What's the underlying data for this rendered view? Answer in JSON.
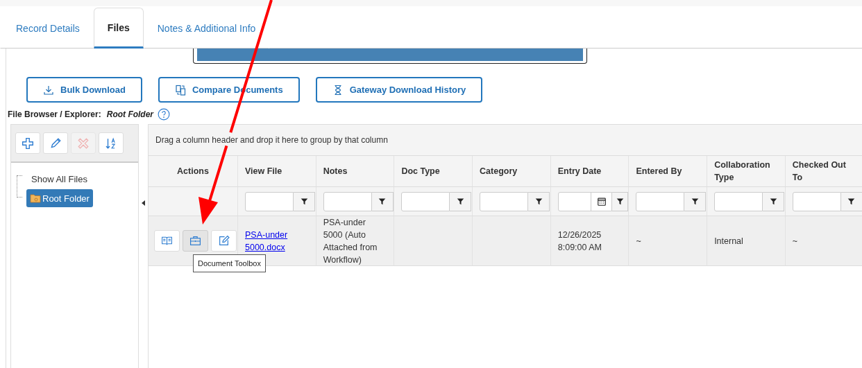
{
  "tabs": [
    {
      "label": "Record Details",
      "selected": false
    },
    {
      "label": "Files",
      "selected": true
    },
    {
      "label": "Notes & Additional Info",
      "selected": false
    }
  ],
  "toolbar_buttons": [
    {
      "kind": "download",
      "label": "Bulk Download"
    },
    {
      "kind": "compare",
      "label": "Compare Documents"
    },
    {
      "kind": "hourglass",
      "label": "Gateway Download History"
    }
  ],
  "file_browser": {
    "label": "File Browser / Explorer:",
    "folder": "Root Folder"
  },
  "tree_toolbar": [
    {
      "kind": "add",
      "disabled": false
    },
    {
      "kind": "edit",
      "disabled": false
    },
    {
      "kind": "delete",
      "disabled": true
    },
    {
      "kind": "sort",
      "disabled": false
    }
  ],
  "tree": [
    {
      "label": "Show All Files",
      "kind": "all",
      "selected": false
    },
    {
      "label": "Root Folder",
      "kind": "folder",
      "selected": true
    }
  ],
  "grid": {
    "group_hint": "Drag a column header and drop it here to group by that column",
    "columns": [
      {
        "title": "Actions",
        "kind": "actions"
      },
      {
        "title": "View File",
        "kind": "link"
      },
      {
        "title": "Notes",
        "kind": "text"
      },
      {
        "title": "Doc Type",
        "kind": "text"
      },
      {
        "title": "Category",
        "kind": "text"
      },
      {
        "title": "Entry Date",
        "kind": "date"
      },
      {
        "title": "Entered By",
        "kind": "text"
      },
      {
        "title": "Collaboration Type",
        "kind": "text"
      },
      {
        "title": "Checked Out To",
        "kind": "text"
      }
    ],
    "rows": [
      {
        "actions": [
          {
            "kind": "read",
            "hovered": false
          },
          {
            "kind": "toolbox",
            "hovered": true,
            "tooltip": "Document Toolbox"
          },
          {
            "kind": "edit",
            "hovered": false
          }
        ],
        "cells": [
          "",
          "PSA-under 5000.docx",
          "PSA-under 5000 (Auto Attached from Workflow)",
          "",
          "",
          "12/26/2025 8:09:00 AM",
          "~",
          "Internal",
          "~"
        ]
      }
    ]
  }
}
